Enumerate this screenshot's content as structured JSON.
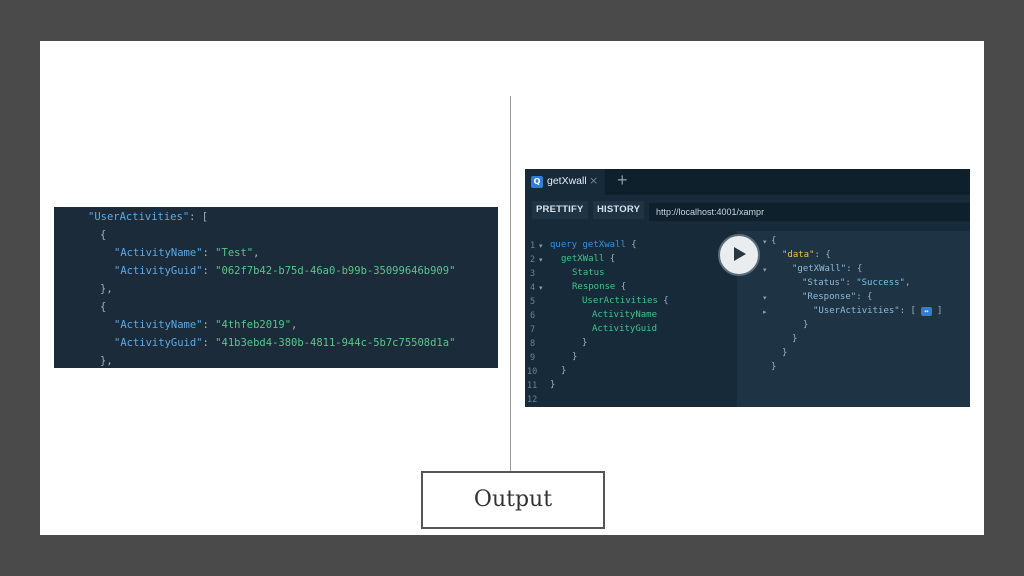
{
  "left_json": {
    "lines": [
      {
        "k": "\"UserActivities\"",
        "p": ": ["
      },
      {
        "p": "{"
      },
      {
        "k": "\"ActivityName\"",
        "p": ": ",
        "s": "\"Test\"",
        "e": ","
      },
      {
        "k": "\"ActivityGuid\"",
        "p": ": ",
        "s": "\"062f7b42-b75d-46a0-b99b-35099646b909\""
      },
      {
        "p": "},"
      },
      {
        "p": "{"
      },
      {
        "k": "\"ActivityName\"",
        "p": ": ",
        "s": "\"4thfeb2019\"",
        "e": ","
      },
      {
        "k": "\"ActivityGuid\"",
        "p": ": ",
        "s": "\"41b3ebd4-380b-4811-944c-5b7c75508d1a\""
      },
      {
        "p": "},"
      }
    ]
  },
  "graphql": {
    "tab_logo": "Q",
    "tab_title": "getXwall",
    "tab_close": "×",
    "tab_add": "+",
    "prettify_label": "PRETTIFY",
    "history_label": "HISTORY",
    "url": "http://localhost:4001/xampr",
    "line_numbers": [
      "1",
      "2",
      "3",
      "4",
      "5",
      "6",
      "7",
      "8",
      "9",
      "10",
      "11",
      "12"
    ],
    "query": {
      "l1_kw": "query",
      "l1_name": "getXwall",
      "l1_brace": "{",
      "l2_field": "getXWall",
      "l2_brace": "{",
      "l3_field": "Status",
      "l4_field": "Response",
      "l4_brace": "{",
      "l5_field": "UserActivities",
      "l5_brace": "{",
      "l6_field": "ActivityName",
      "l7_field": "ActivityGuid",
      "close": "}"
    },
    "result": {
      "open": "{",
      "data_key": "\"data\"",
      "data_rest": ": {",
      "getxwall_key": "\"getXWall\"",
      "getxwall_rest": ": {",
      "status_key": "\"Status\"",
      "status_sep": ": ",
      "status_val": "\"Success\"",
      "status_end": ",",
      "response_key": "\"Response\"",
      "response_rest": ": {",
      "ua_key": "\"UserActivities\"",
      "ua_sep": ": [",
      "ua_expand": "↔",
      "ua_close": "]",
      "close": "}"
    }
  },
  "output_label": "Output"
}
